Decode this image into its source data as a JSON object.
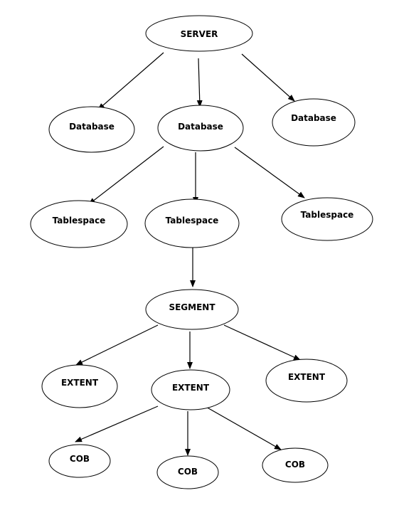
{
  "nodes": [
    {
      "id": "server",
      "label": "SERVER"
    },
    {
      "id": "db1",
      "label": "Database"
    },
    {
      "id": "db2",
      "label": "Database"
    },
    {
      "id": "db3",
      "label": "Database"
    },
    {
      "id": "ts1",
      "label": "Tablespace"
    },
    {
      "id": "ts2",
      "label": "Tablespace"
    },
    {
      "id": "ts3",
      "label": "Tablespace"
    },
    {
      "id": "segment",
      "label": "SEGMENT"
    },
    {
      "id": "ext1",
      "label": "EXTENT"
    },
    {
      "id": "ext2",
      "label": "EXTENT"
    },
    {
      "id": "ext3",
      "label": "EXTENT"
    },
    {
      "id": "cob1",
      "label": "COB"
    },
    {
      "id": "cob2",
      "label": "COB"
    },
    {
      "id": "cob3",
      "label": "COB"
    }
  ],
  "edges": [
    [
      "server",
      "db1"
    ],
    [
      "server",
      "db2"
    ],
    [
      "server",
      "db3"
    ],
    [
      "db2",
      "ts1"
    ],
    [
      "db2",
      "ts2"
    ],
    [
      "db2",
      "ts3"
    ],
    [
      "ts2",
      "segment"
    ],
    [
      "segment",
      "ext1"
    ],
    [
      "segment",
      "ext2"
    ],
    [
      "segment",
      "ext3"
    ],
    [
      "ext2",
      "cob1"
    ],
    [
      "ext2",
      "cob2"
    ],
    [
      "ext2",
      "cob3"
    ]
  ]
}
